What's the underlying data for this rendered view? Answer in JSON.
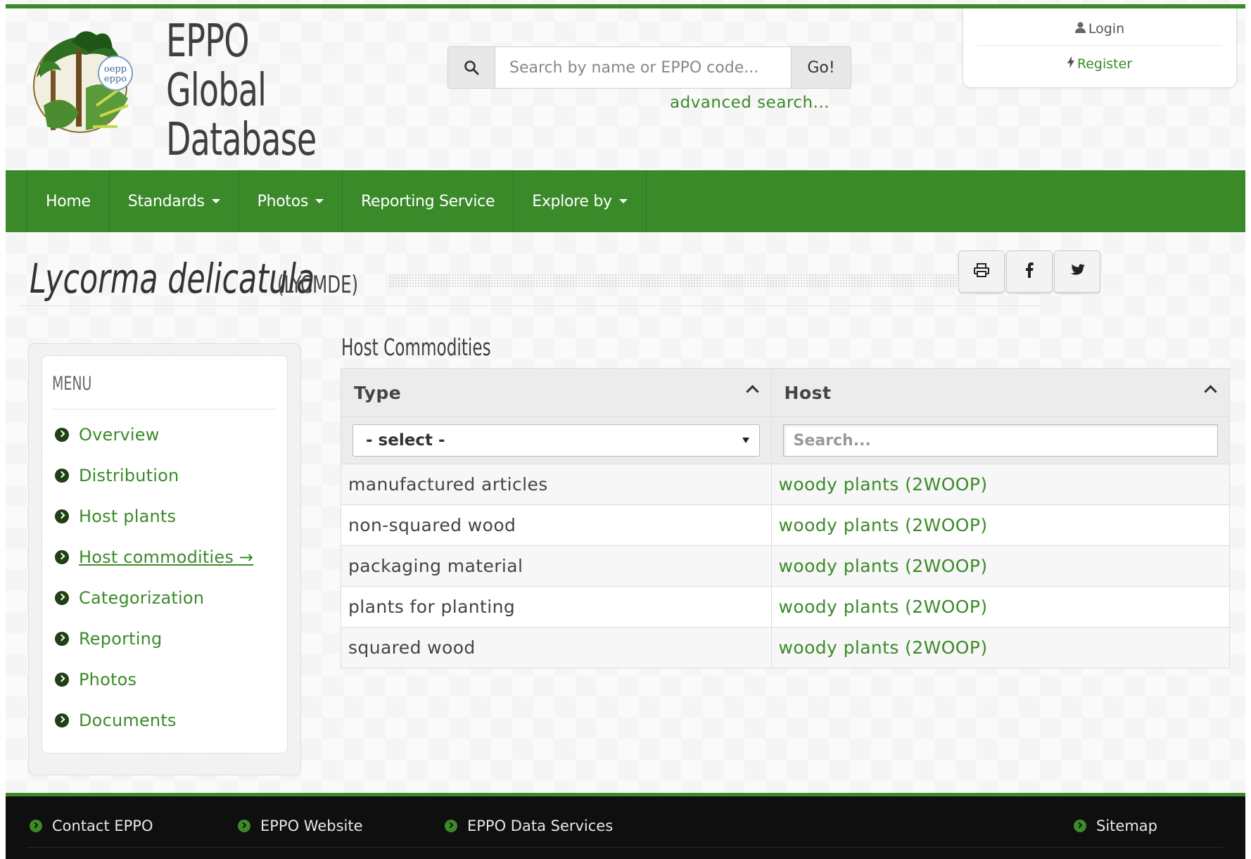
{
  "header": {
    "brand_line1": "EPPO",
    "brand_line2": "Global",
    "brand_line3": "Database",
    "logo_text": "oepp eppo",
    "search_placeholder": "Search by name or EPPO code...",
    "go_label": "Go!",
    "advanced_search": "advanced search..."
  },
  "account": {
    "login": "Login",
    "register": "Register"
  },
  "nav": {
    "items": [
      {
        "label": "Home",
        "dropdown": false
      },
      {
        "label": "Standards",
        "dropdown": true
      },
      {
        "label": "Photos",
        "dropdown": true
      },
      {
        "label": "Reporting Service",
        "dropdown": false
      },
      {
        "label": "Explore by",
        "dropdown": true
      }
    ]
  },
  "title": {
    "species": "Lycorma delicatula",
    "code": "(LYCMDE)"
  },
  "share": {
    "print_icon": "print-icon",
    "facebook_icon": "facebook-icon",
    "twitter_icon": "twitter-icon"
  },
  "menu": {
    "title": "MENU",
    "items": [
      {
        "label": "Overview",
        "active": false
      },
      {
        "label": "Distribution",
        "active": false
      },
      {
        "label": "Host plants",
        "active": false
      },
      {
        "label": "Host commodities →",
        "active": true
      },
      {
        "label": "Categorization",
        "active": false
      },
      {
        "label": "Reporting",
        "active": false
      },
      {
        "label": "Photos",
        "active": false
      },
      {
        "label": "Documents",
        "active": false
      }
    ]
  },
  "section": {
    "title": "Host Commodities"
  },
  "table": {
    "columns": [
      "Type",
      "Host"
    ],
    "type_filter_value": "- select -",
    "host_filter_placeholder": "Search...",
    "rows": [
      {
        "type": "manufactured articles",
        "host": "woody plants (2WOOP)"
      },
      {
        "type": "non-squared wood",
        "host": "woody plants (2WOOP)"
      },
      {
        "type": "packaging material",
        "host": "woody plants (2WOOP)"
      },
      {
        "type": "plants for planting",
        "host": "woody plants (2WOOP)"
      },
      {
        "type": "squared wood",
        "host": "woody plants (2WOOP)"
      }
    ]
  },
  "footer": {
    "contact": "Contact EPPO",
    "website": "EPPO Website",
    "data_services": "EPPO Data Services",
    "sitemap": "Sitemap"
  },
  "colors": {
    "accent": "#3b8a2a",
    "footer_bg": "#0f0f0f"
  }
}
